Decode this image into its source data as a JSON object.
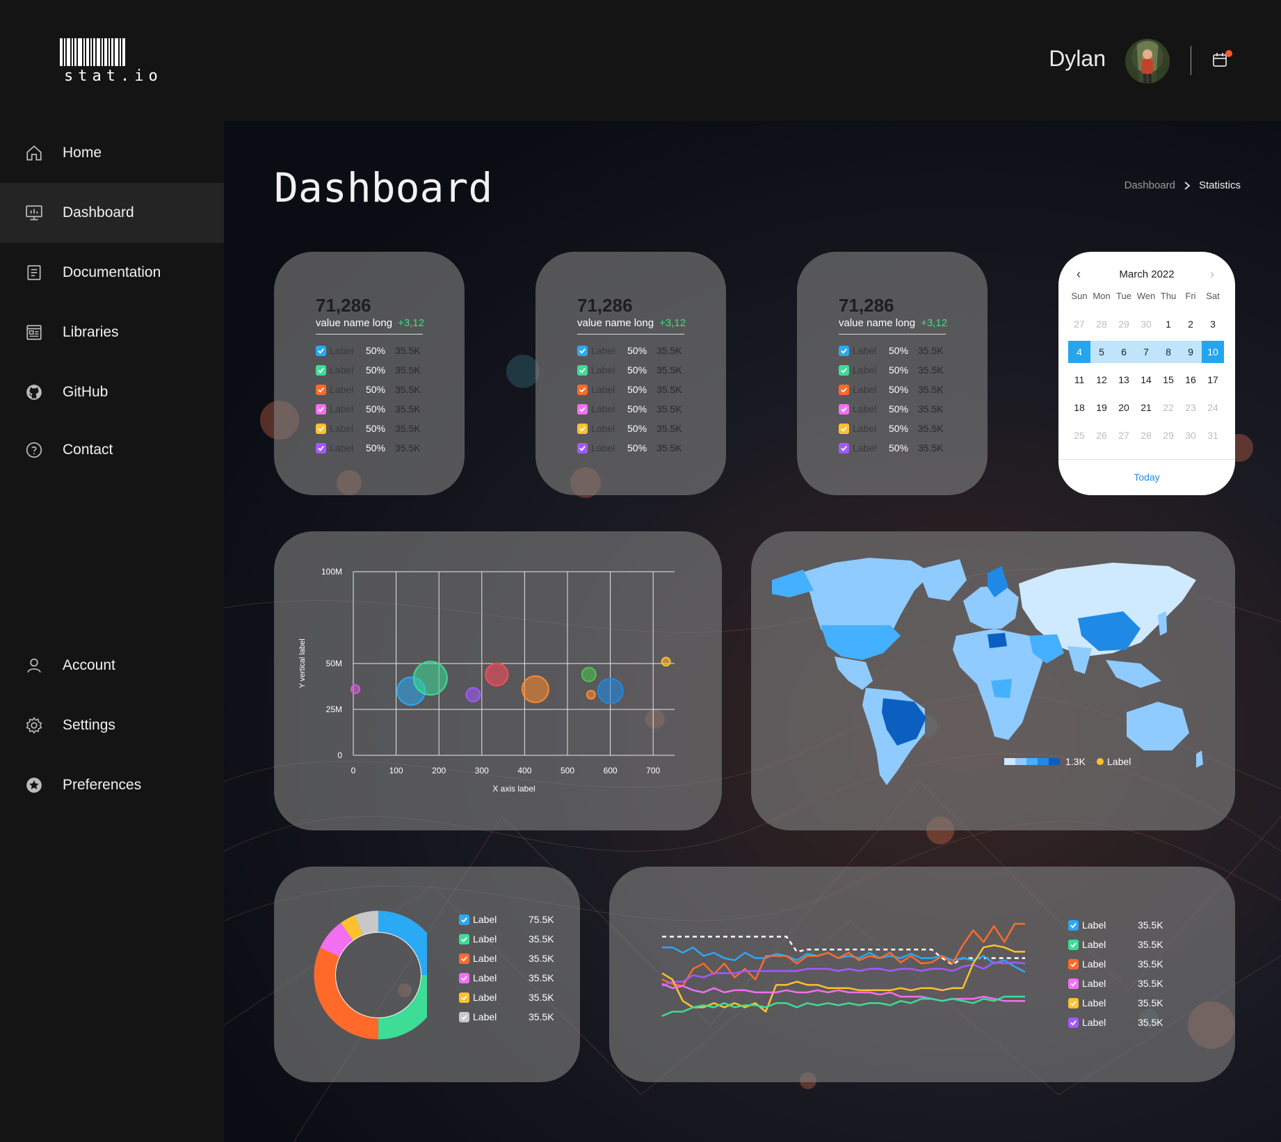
{
  "brand": {
    "name": "stat.io"
  },
  "user": {
    "name": "Dylan"
  },
  "sidebar": {
    "items": [
      {
        "label": "Home",
        "icon": "home-icon"
      },
      {
        "label": "Dashboard",
        "icon": "monitor-icon",
        "active": true
      },
      {
        "label": "Documentation",
        "icon": "document-icon"
      },
      {
        "label": "Libraries",
        "icon": "library-icon"
      },
      {
        "label": "GitHub",
        "icon": "github-icon"
      },
      {
        "label": "Contact",
        "icon": "help-circle-icon"
      },
      {
        "label": "Account",
        "icon": "user-icon"
      },
      {
        "label": "Settings",
        "icon": "gear-icon"
      },
      {
        "label": "Preferences",
        "icon": "star-icon"
      }
    ]
  },
  "page": {
    "title": "Dashboard",
    "breadcrumb": [
      "Dashboard",
      "Statistics"
    ]
  },
  "colors": {
    "blue": "#2aa9f4",
    "green": "#3ddc97",
    "orange": "#ff6a2b",
    "pink": "#f26ff2",
    "yellow": "#ffc12e",
    "purple": "#a259ff",
    "gray": "#c8c8c8"
  },
  "stat_cards": [
    {
      "value": "71,286",
      "name": "value name long",
      "delta": "+3,12",
      "rows": [
        {
          "label": "Label",
          "pct": "50%",
          "value": "35.5K",
          "color": "blue"
        },
        {
          "label": "Label",
          "pct": "50%",
          "value": "35.5K",
          "color": "green"
        },
        {
          "label": "Label",
          "pct": "50%",
          "value": "35.5K",
          "color": "orange"
        },
        {
          "label": "Label",
          "pct": "50%",
          "value": "35.5K",
          "color": "pink"
        },
        {
          "label": "Label",
          "pct": "50%",
          "value": "35.5K",
          "color": "yellow"
        },
        {
          "label": "Label",
          "pct": "50%",
          "value": "35.5K",
          "color": "purple"
        }
      ]
    },
    {
      "value": "71,286",
      "name": "value name long",
      "delta": "+3,12",
      "rows": [
        {
          "label": "Label",
          "pct": "50%",
          "value": "35.5K",
          "color": "blue"
        },
        {
          "label": "Label",
          "pct": "50%",
          "value": "35.5K",
          "color": "green"
        },
        {
          "label": "Label",
          "pct": "50%",
          "value": "35.5K",
          "color": "orange"
        },
        {
          "label": "Label",
          "pct": "50%",
          "value": "35.5K",
          "color": "pink"
        },
        {
          "label": "Label",
          "pct": "50%",
          "value": "35.5K",
          "color": "yellow"
        },
        {
          "label": "Label",
          "pct": "50%",
          "value": "35.5K",
          "color": "purple"
        }
      ]
    },
    {
      "value": "71,286",
      "name": "value name long",
      "delta": "+3,12",
      "rows": [
        {
          "label": "Label",
          "pct": "50%",
          "value": "35.5K",
          "color": "blue"
        },
        {
          "label": "Label",
          "pct": "50%",
          "value": "35.5K",
          "color": "green"
        },
        {
          "label": "Label",
          "pct": "50%",
          "value": "35.5K",
          "color": "orange"
        },
        {
          "label": "Label",
          "pct": "50%",
          "value": "35.5K",
          "color": "pink"
        },
        {
          "label": "Label",
          "pct": "50%",
          "value": "35.5K",
          "color": "yellow"
        },
        {
          "label": "Label",
          "pct": "50%",
          "value": "35.5K",
          "color": "purple"
        }
      ]
    }
  ],
  "calendar": {
    "title": "March 2022",
    "weekdays": [
      "Sun",
      "Mon",
      "Tue",
      "Wen",
      "Thu",
      "Fri",
      "Sat"
    ],
    "weeks": [
      [
        [
          "27",
          "muted"
        ],
        [
          "28",
          "muted"
        ],
        [
          "29",
          "muted"
        ],
        [
          "30",
          "muted"
        ],
        [
          "1",
          ""
        ],
        [
          "2",
          ""
        ],
        [
          "3",
          ""
        ]
      ],
      [
        [
          "4",
          "sel"
        ],
        [
          "5",
          "range"
        ],
        [
          "6",
          "range"
        ],
        [
          "7",
          "range"
        ],
        [
          "8",
          "range"
        ],
        [
          "9",
          "range"
        ],
        [
          "10",
          "sel"
        ]
      ],
      [
        [
          "11",
          ""
        ],
        [
          "12",
          ""
        ],
        [
          "13",
          ""
        ],
        [
          "14",
          ""
        ],
        [
          "15",
          ""
        ],
        [
          "16",
          ""
        ],
        [
          "17",
          ""
        ]
      ],
      [
        [
          "18",
          ""
        ],
        [
          "19",
          ""
        ],
        [
          "20",
          ""
        ],
        [
          "21",
          ""
        ],
        [
          "22",
          "muted"
        ],
        [
          "23",
          "muted"
        ],
        [
          "24",
          "muted"
        ]
      ],
      [
        [
          "25",
          "muted"
        ],
        [
          "26",
          "muted"
        ],
        [
          "27",
          "muted"
        ],
        [
          "28",
          "muted"
        ],
        [
          "29",
          "muted"
        ],
        [
          "30",
          "muted"
        ],
        [
          "31",
          "muted"
        ]
      ]
    ],
    "today_label": "Today"
  },
  "map": {
    "legend_value": "1.3K",
    "legend_label": "Label",
    "legend_scale": [
      "#cfe9ff",
      "#8fcbff",
      "#45b0ff",
      "#1e8ae6",
      "#0b5fc0"
    ],
    "marker_color": "#ffc12e"
  },
  "donut_legend": [
    {
      "label": "Label",
      "value": "75.5K",
      "color": "blue"
    },
    {
      "label": "Label",
      "value": "35.5K",
      "color": "green"
    },
    {
      "label": "Label",
      "value": "35.5K",
      "color": "orange"
    },
    {
      "label": "Label",
      "value": "35.5K",
      "color": "pink"
    },
    {
      "label": "Label",
      "value": "35.5K",
      "color": "yellow"
    },
    {
      "label": "Label",
      "value": "35.5K",
      "color": "gray"
    }
  ],
  "line_legend": [
    {
      "label": "Label",
      "value": "35.5K",
      "color": "blue"
    },
    {
      "label": "Label",
      "value": "35.5K",
      "color": "green"
    },
    {
      "label": "Label",
      "value": "35.5K",
      "color": "orange"
    },
    {
      "label": "Label",
      "value": "35.5K",
      "color": "pink"
    },
    {
      "label": "Label",
      "value": "35.5K",
      "color": "yellow"
    },
    {
      "label": "Label",
      "value": "35.5K",
      "color": "purple"
    }
  ],
  "chart_data": [
    {
      "type": "scatter",
      "xlabel": "X axis label",
      "ylabel": "Y vertical label",
      "xlim": [
        0,
        750
      ],
      "ylim": [
        0,
        100
      ],
      "x_ticks": [
        "0",
        "100",
        "200",
        "300",
        "400",
        "500",
        "600",
        "700"
      ],
      "y_ticks": [
        "0",
        "25M",
        "50M",
        "100M"
      ],
      "points": [
        {
          "x": 5,
          "y": 36,
          "r": 6,
          "color": "#d85ad8"
        },
        {
          "x": 135,
          "y": 35,
          "r": 20,
          "color": "#2aa9f4"
        },
        {
          "x": 180,
          "y": 42,
          "r": 24,
          "color": "#3ddc97"
        },
        {
          "x": 280,
          "y": 33,
          "r": 10,
          "color": "#a259ff"
        },
        {
          "x": 335,
          "y": 44,
          "r": 16,
          "color": "#ff4a5a"
        },
        {
          "x": 425,
          "y": 36,
          "r": 19,
          "color": "#ff8a2b"
        },
        {
          "x": 550,
          "y": 44,
          "r": 10,
          "color": "#4fc24f"
        },
        {
          "x": 555,
          "y": 33,
          "r": 6,
          "color": "#ff8a2b"
        },
        {
          "x": 600,
          "y": 35,
          "r": 18,
          "color": "#1e8ae6"
        },
        {
          "x": 730,
          "y": 51,
          "r": 6,
          "color": "#ffc12e"
        }
      ]
    },
    {
      "type": "pie",
      "donut": true,
      "slices": [
        {
          "value": 25,
          "color": "#2aa9f4"
        },
        {
          "value": 25,
          "color": "#3ddc97"
        },
        {
          "value": 32,
          "color": "#ff6a2b"
        },
        {
          "value": 8,
          "color": "#f26ff2"
        },
        {
          "value": 4,
          "color": "#ffc12e"
        },
        {
          "value": 6,
          "color": "#c8c8c8"
        }
      ]
    },
    {
      "type": "line",
      "x": [
        0,
        1,
        2,
        3,
        4,
        5,
        6,
        7,
        8,
        9,
        10,
        11,
        12,
        13,
        14,
        15,
        16,
        17,
        18,
        19,
        20,
        21,
        22,
        23,
        24,
        25,
        26,
        27,
        28,
        29,
        30,
        31,
        32,
        33,
        34,
        35
      ],
      "ylim": [
        0,
        100
      ],
      "series": [
        {
          "color": "#ffffff",
          "dashed": true,
          "values": [
            80,
            80,
            80,
            80,
            80,
            80,
            80,
            80,
            80,
            80,
            80,
            80,
            80,
            66,
            68,
            68,
            68,
            68,
            68,
            68,
            68,
            68,
            68,
            68,
            68,
            68,
            68,
            60,
            54,
            60,
            60,
            60,
            60,
            60,
            60,
            60
          ]
        },
        {
          "color": "#2aa9f4",
          "values": [
            70,
            70,
            65,
            70,
            62,
            65,
            60,
            58,
            65,
            60,
            60,
            64,
            62,
            58,
            64,
            62,
            65,
            60,
            62,
            60,
            65,
            60,
            62,
            60,
            64,
            60,
            60,
            62,
            58,
            60,
            58,
            62,
            55,
            58,
            52,
            47
          ]
        },
        {
          "color": "#ff6a2b",
          "values": [
            40,
            36,
            34,
            50,
            55,
            45,
            55,
            42,
            50,
            40,
            62,
            62,
            62,
            55,
            62,
            62,
            65,
            60,
            65,
            58,
            62,
            60,
            65,
            56,
            62,
            55,
            56,
            62,
            55,
            72,
            86,
            75,
            90,
            75,
            92,
            92
          ]
        },
        {
          "color": "#a259ff",
          "values": [
            34,
            38,
            38,
            44,
            42,
            46,
            46,
            46,
            48,
            48,
            48,
            48,
            48,
            48,
            50,
            50,
            50,
            48,
            50,
            48,
            50,
            50,
            48,
            50,
            50,
            48,
            50,
            50,
            48,
            52,
            54,
            50,
            56,
            55,
            56,
            55
          ]
        },
        {
          "color": "#ffc12e",
          "values": [
            46,
            40,
            20,
            14,
            14,
            18,
            14,
            18,
            14,
            18,
            10,
            35,
            35,
            38,
            35,
            35,
            32,
            32,
            32,
            30,
            30,
            30,
            30,
            32,
            30,
            32,
            32,
            30,
            32,
            32,
            55,
            70,
            72,
            70,
            66,
            66
          ]
        },
        {
          "color": "#f26ff2",
          "values": [
            36,
            32,
            34,
            30,
            28,
            32,
            28,
            30,
            30,
            28,
            28,
            28,
            30,
            28,
            28,
            30,
            28,
            30,
            28,
            28,
            28,
            26,
            28,
            24,
            24,
            24,
            22,
            20,
            22,
            22,
            22,
            24,
            22,
            20,
            20,
            20
          ]
        },
        {
          "color": "#3ddc97",
          "values": [
            6,
            10,
            10,
            14,
            16,
            14,
            18,
            14,
            16,
            16,
            14,
            18,
            18,
            14,
            18,
            16,
            18,
            16,
            18,
            16,
            18,
            18,
            16,
            20,
            18,
            22,
            22,
            20,
            22,
            20,
            18,
            22,
            20,
            24,
            24,
            24
          ]
        }
      ]
    }
  ]
}
